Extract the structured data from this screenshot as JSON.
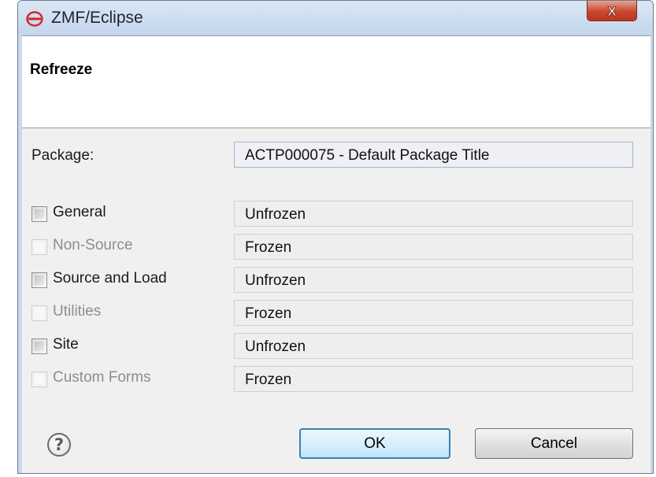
{
  "window": {
    "title": "ZMF/Eclipse",
    "app_icon": "zmf-logo-icon",
    "close_icon": "close-icon",
    "close_glyph": "X"
  },
  "dialog": {
    "heading": "Refreeze",
    "package_label": "Package:",
    "package_value": "ACTP000075 - Default Package Title"
  },
  "components": [
    {
      "label": "General",
      "enabled": true,
      "checked": false,
      "status": "Unfrozen"
    },
    {
      "label": "Non-Source",
      "enabled": false,
      "checked": false,
      "status": "Frozen"
    },
    {
      "label": "Source and Load",
      "enabled": true,
      "checked": false,
      "status": "Unfrozen"
    },
    {
      "label": "Utilities",
      "enabled": false,
      "checked": false,
      "status": "Frozen"
    },
    {
      "label": "Site",
      "enabled": true,
      "checked": false,
      "status": "Unfrozen"
    },
    {
      "label": "Custom Forms",
      "enabled": false,
      "checked": false,
      "status": "Frozen"
    }
  ],
  "footer": {
    "help_icon": "help-icon",
    "help_glyph": "?",
    "ok_label": "OK",
    "cancel_label": "Cancel"
  }
}
